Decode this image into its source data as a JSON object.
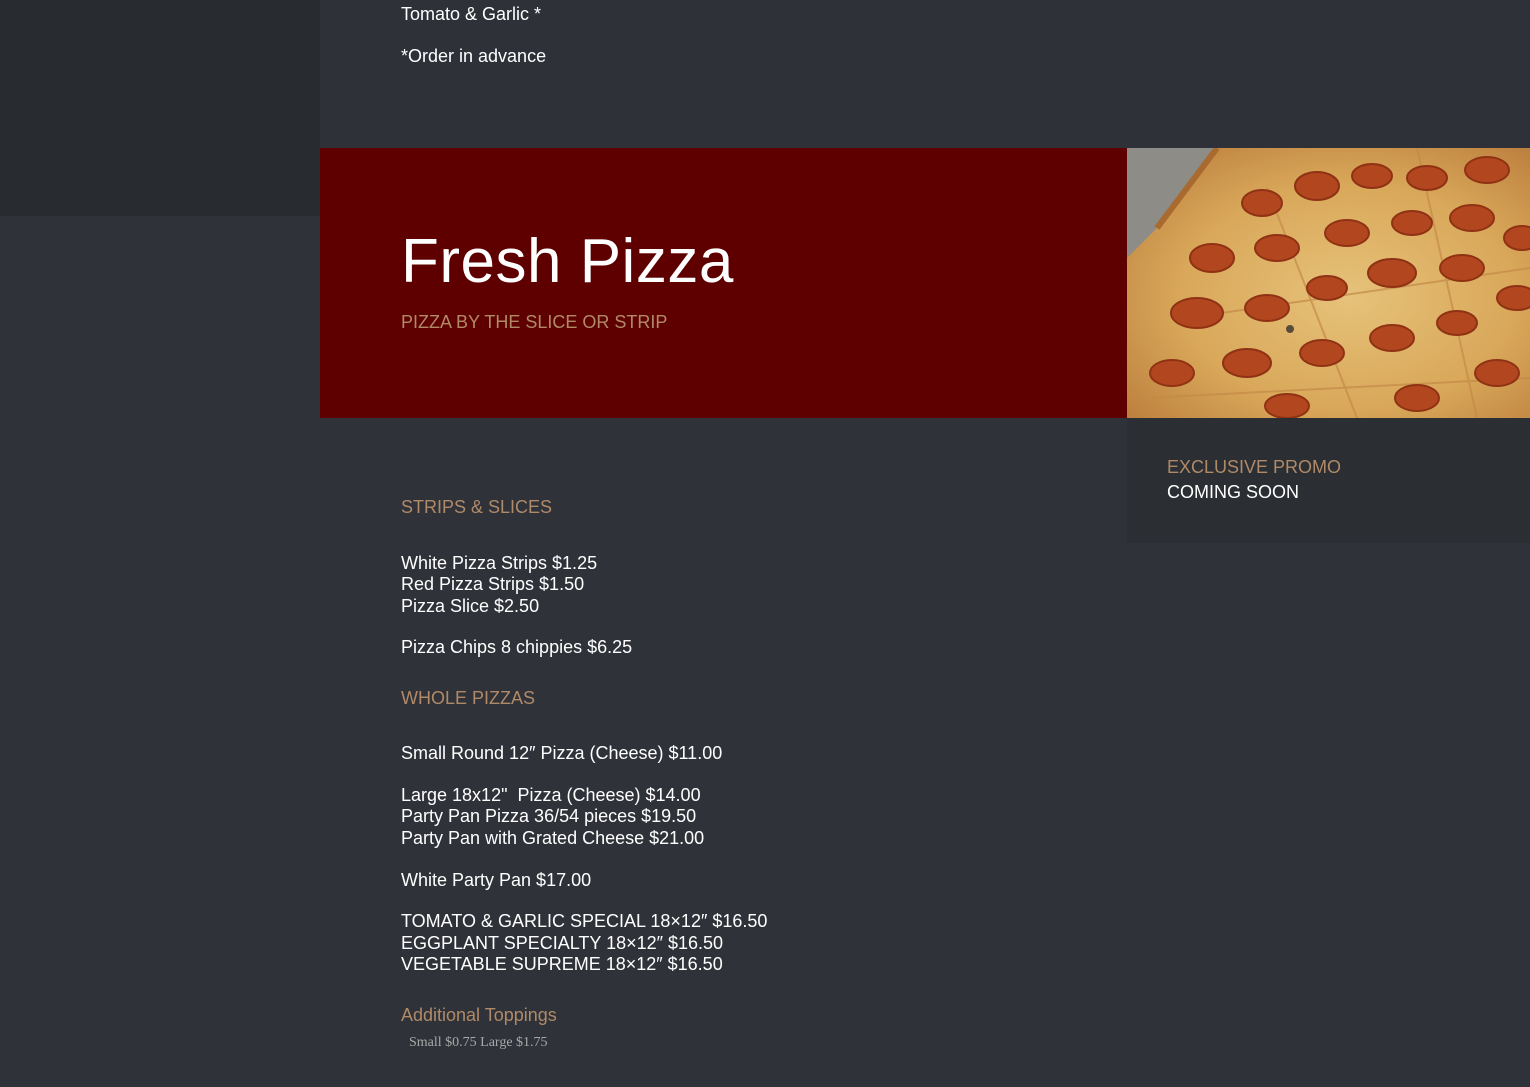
{
  "top_section": {
    "line_1": "Tomato & Garlic *",
    "line_2": "*Order in advance"
  },
  "hero": {
    "title": "Fresh Pizza",
    "subtitle": "PIZZA BY THE SLICE OR STRIP"
  },
  "promo": {
    "kicker": "EXCLUSIVE PROMO",
    "text": "COMING SOON"
  },
  "strips_slices": {
    "heading": "STRIPS & SLICES",
    "items": [
      "White Pizza Strips $1.25",
      "Red Pizza Strips $1.50",
      "Pizza Slice $2.50",
      "Pizza Chips 8 chippies $6.25"
    ]
  },
  "whole_pizzas": {
    "heading": "WHOLE PIZZAS",
    "items": [
      "Small Round 12″ Pizza (Cheese) $11.00",
      "Large 18x12\"  Pizza (Cheese) $14.00",
      "Party Pan Pizza 36/54 pieces $19.50",
      "Party Pan with Grated Cheese $21.00",
      "White Party Pan $17.00",
      "TOMATO & GARLIC SPECIAL 18×12″ $16.50",
      "EGGPLANT SPECIALTY 18×12″ $16.50",
      "VEGETABLE SUPREME 18×12″ $16.50"
    ]
  },
  "toppings": {
    "heading": "Additional Toppings",
    "note": "Small $0.75 Large $1.75"
  },
  "colors": {
    "page_bg": "#2f3238",
    "hero_bg": "#5e0000",
    "accent": "#b08a68",
    "text": "#ffffff"
  }
}
